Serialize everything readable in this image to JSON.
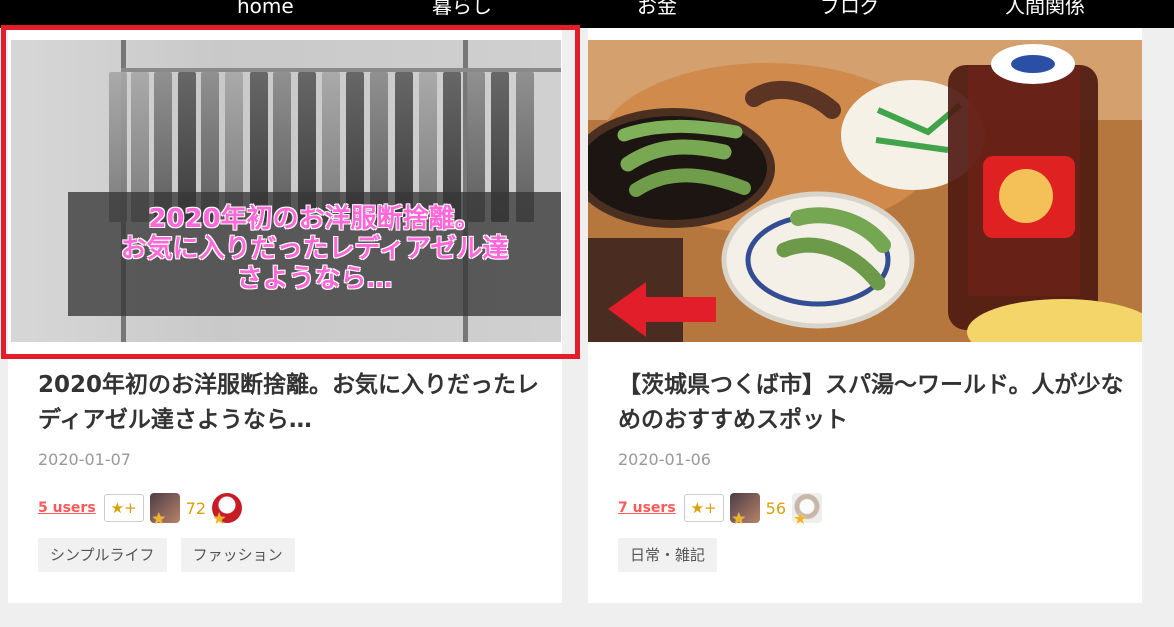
{
  "nav": {
    "items": [
      {
        "label": "home"
      },
      {
        "label": "暮らし"
      },
      {
        "label": "お金"
      },
      {
        "label": "ブログ"
      },
      {
        "label": "人間関係"
      }
    ]
  },
  "posts": [
    {
      "image_text": "2020年初のお洋服断捨離。\nお気に入りだったレディアゼル達\nさようなら…",
      "title": "2020年初のお洋服断捨離。お気に入りだったレディアゼル達さようなら…",
      "date": "2020-01-07",
      "users": "5 users",
      "star_button": "★+",
      "count": "72",
      "tags": [
        "シンプルライフ",
        "ファッション"
      ]
    },
    {
      "title": "【茨城県つくば市】スパ湯～ワールド。人が少なめのおすすめスポット",
      "date": "2020-01-06",
      "users": "7 users",
      "star_button": "★+",
      "count": "56",
      "tags": [
        "日常・雑記"
      ]
    }
  ],
  "colors": {
    "highlight": "#e11e2a",
    "users": "#ff5a5a",
    "accent": "#d7a10b"
  },
  "icons": {
    "arrow": "red-left-arrow-icon"
  }
}
